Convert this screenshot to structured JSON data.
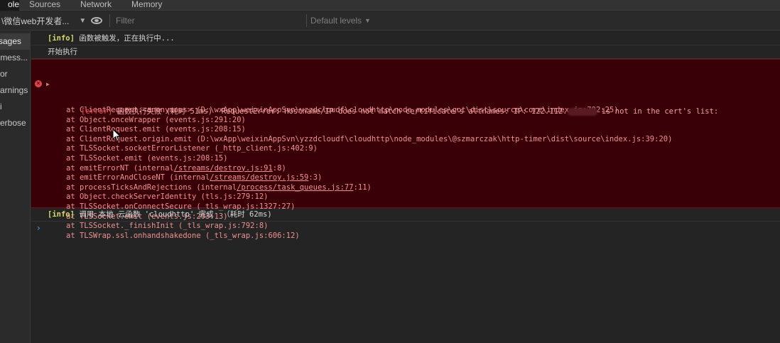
{
  "tabs": [
    {
      "label": "ole",
      "active": true
    },
    {
      "label": "Sources",
      "active": false
    },
    {
      "label": "Network",
      "active": false
    },
    {
      "label": "Memory",
      "active": false
    }
  ],
  "toolbar": {
    "context": "\\微信web开发者...",
    "filter_placeholder": "Filter",
    "levels": "Default levels"
  },
  "sidebar": {
    "items": [
      {
        "label": "ssages",
        "active": true
      },
      {
        "label": "r mess..."
      },
      {
        "label": "or"
      },
      {
        "label": "arnings"
      },
      {
        "label": "i"
      },
      {
        "label": "erbose"
      }
    ]
  },
  "console": {
    "line1": {
      "tag": "[info]",
      "text": " 函数被触发，正在执行中..."
    },
    "line2": {
      "text": "开始执行"
    },
    "error": {
      "tag": "[error]",
      "head_a": " 函数执行失败 (耗时 51ms)  RequestError: Hostname/IP does not match certificate's altnames: IP: 122.112.",
      "head_b": " is not in the cert's list:",
      "stack": [
        {
          "pre": "at ClientRequest.<anonymous> (D:\\wxApp\\weixinAppSvn\\yzzdcloudf\\cloudhttp\\node_modules\\got\\dist\\source\\core\\index.js:792:25)"
        },
        {
          "pre": "at Object.onceWrapper (events.js:291:20)"
        },
        {
          "pre": "at ClientRequest.emit (events.js:208:15)"
        },
        {
          "pre": "at ClientRequest.origin.emit (D:\\wxApp\\weixinAppSvn\\yzzdcloudf\\cloudhttp\\node_modules\\@szmarczak\\http-timer\\dist\\source\\index.js:39:20)"
        },
        {
          "pre": "at TLSSocket.socketErrorListener (_http_client.js:402:9)"
        },
        {
          "pre": "at TLSSocket.emit (events.js:208:15)"
        },
        {
          "pre": "at emitErrorNT (internal",
          "link": "/streams/destroy.js:91",
          "post": ":8)"
        },
        {
          "pre": "at emitErrorAndCloseNT (internal",
          "link": "/streams/destroy.js:59",
          "post": ":3)"
        },
        {
          "pre": "at processTicksAndRejections (internal",
          "link": "/process/task_queues.js:77",
          "post": ":11)"
        },
        {
          "pre": "at Object.checkServerIdentity (tls.js:279:12)"
        },
        {
          "pre": "at TLSSocket.onConnectSecure (_tls_wrap.js:1327:27)"
        },
        {
          "pre": "at TLSSocket.emit (events.js:203:13)"
        },
        {
          "pre": "at TLSSocket._finishInit (_tls_wrap.js:792:8)"
        },
        {
          "pre": "at TLSWrap.ssl.onhandshakedone (_tls_wrap.js:606:12)"
        }
      ]
    },
    "line3": {
      "tag": "[info]",
      "text": " 调用 本地 云函数 'cloudhttp' 完成  （耗时 62ms)"
    },
    "prompt": "›"
  },
  "colors": {
    "background": "#242424",
    "error_bg": "#3a0008",
    "error_text": "#f09090",
    "info_tag": "#d8d86a",
    "prompt": "#4d9cf0"
  }
}
